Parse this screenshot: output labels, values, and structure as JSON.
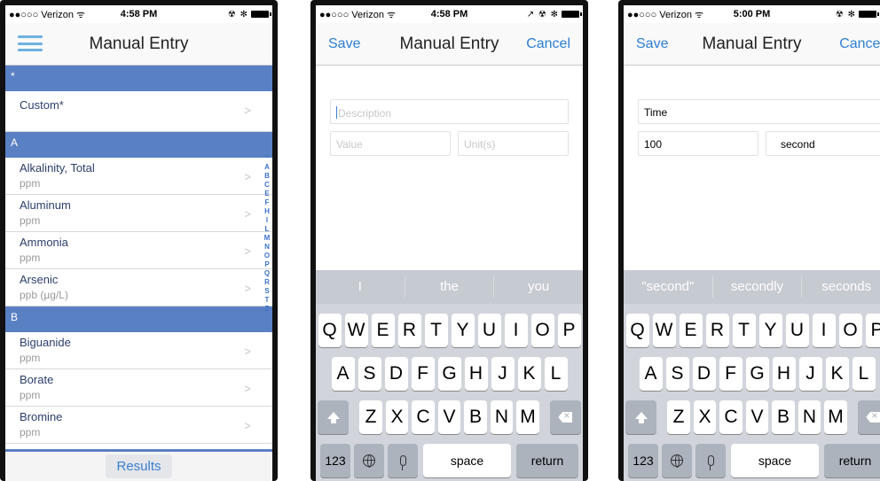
{
  "screens": [
    {
      "status": {
        "carrier": "●●○○○ Verizon ᯤ",
        "time": "4:58 PM",
        "icons": "☢ ✻"
      },
      "title": "Manual Entry",
      "sections": [
        {
          "header": "*",
          "items": [
            {
              "name": "Custom*",
              "unit": ""
            }
          ]
        },
        {
          "header": "A",
          "items": [
            {
              "name": "Alkalinity, Total",
              "unit": "ppm"
            },
            {
              "name": "Aluminum",
              "unit": "ppm"
            },
            {
              "name": "Ammonia",
              "unit": "ppm"
            },
            {
              "name": "Arsenic",
              "unit": "ppb (µg/L)"
            }
          ]
        },
        {
          "header": "B",
          "items": [
            {
              "name": "Biguanide",
              "unit": "ppm"
            },
            {
              "name": "Borate",
              "unit": "ppm"
            },
            {
              "name": "Bromine",
              "unit": "ppm"
            }
          ]
        }
      ],
      "index_letters": [
        "*",
        "A",
        "B",
        "C",
        "E",
        "F",
        "H",
        "I",
        "L",
        "M",
        "N",
        "O",
        "P",
        "Q",
        "R",
        "S",
        "T",
        "Z"
      ],
      "results_label": "Results"
    },
    {
      "status": {
        "carrier": "●●○○○ Verizon ᯤ",
        "time": "4:58 PM",
        "icons": "↗ ☢ ✻"
      },
      "title": "Manual Entry",
      "save": "Save",
      "cancel": "Cancel",
      "description_placeholder": "Description",
      "value_placeholder": "Value",
      "unit_placeholder": "Unit(s)",
      "suggestions": [
        "I",
        "the",
        "you"
      ]
    },
    {
      "status": {
        "carrier": "●●○○○ Verizon ᯤ",
        "time": "5:00 PM",
        "icons": "☢ ✻"
      },
      "title": "Manual Entry",
      "save": "Save",
      "cancel": "Cancel",
      "description_value": "Time",
      "value_value": "100",
      "unit_value": "second",
      "suggestions": [
        "\"second\"",
        "secondly",
        "seconds"
      ]
    }
  ],
  "keyboard": {
    "row1": [
      "Q",
      "W",
      "E",
      "R",
      "T",
      "Y",
      "U",
      "I",
      "O",
      "P"
    ],
    "row2": [
      "A",
      "S",
      "D",
      "F",
      "G",
      "H",
      "J",
      "K",
      "L"
    ],
    "row3": [
      "Z",
      "X",
      "C",
      "V",
      "B",
      "N",
      "M"
    ],
    "numbers_key": "123",
    "space_key": "space",
    "return_key": "return"
  },
  "colors": {
    "section_header": "#5a80c4",
    "accent": "#2d7fd4"
  }
}
